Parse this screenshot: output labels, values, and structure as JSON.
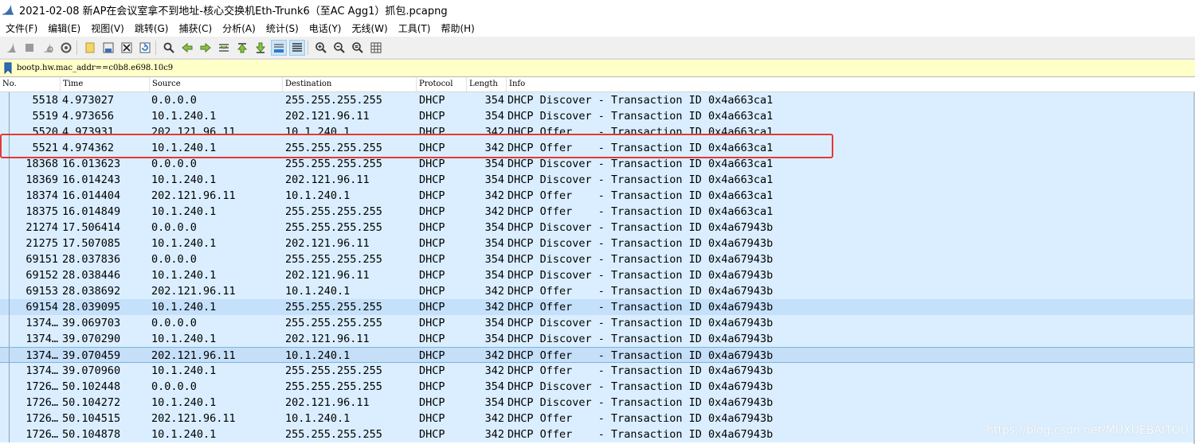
{
  "window": {
    "title": "2021-02-08 新AP在会议室拿不到地址-核心交换机Eth-Trunk6（至AC Agg1）抓包.pcapng"
  },
  "menu": [
    {
      "label": "文件(F)"
    },
    {
      "label": "编辑(E)"
    },
    {
      "label": "视图(V)"
    },
    {
      "label": "跳转(G)"
    },
    {
      "label": "捕获(C)"
    },
    {
      "label": "分析(A)"
    },
    {
      "label": "统计(S)"
    },
    {
      "label": "电话(Y)"
    },
    {
      "label": "无线(W)"
    },
    {
      "label": "工具(T)"
    },
    {
      "label": "帮助(H)"
    }
  ],
  "filter": {
    "value": "bootp.hw.mac_addr==c0b8.e698.10c9",
    "background_color": "#ffffc8"
  },
  "columns": [
    "No.",
    "Time",
    "Source",
    "Destination",
    "Protocol",
    "Length",
    "Info"
  ],
  "packets": [
    {
      "no": "5518",
      "time": "4.973027",
      "src": "0.0.0.0",
      "dst": "255.255.255.255",
      "proto": "DHCP",
      "len": "354",
      "info": "DHCP Discover - Transaction ID 0x4a663ca1"
    },
    {
      "no": "5519",
      "time": "4.973656",
      "src": "10.1.240.1",
      "dst": "202.121.96.11",
      "proto": "DHCP",
      "len": "354",
      "info": "DHCP Discover - Transaction ID 0x4a663ca1"
    },
    {
      "no": "5520",
      "time": "4.973931",
      "src": "202.121.96.11",
      "dst": "10.1.240.1",
      "proto": "DHCP",
      "len": "342",
      "info": "DHCP Offer    - Transaction ID 0x4a663ca1"
    },
    {
      "no": "5521",
      "time": "4.974362",
      "src": "10.1.240.1",
      "dst": "255.255.255.255",
      "proto": "DHCP",
      "len": "342",
      "info": "DHCP Offer    - Transaction ID 0x4a663ca1"
    },
    {
      "no": "18368",
      "time": "16.013623",
      "src": "0.0.0.0",
      "dst": "255.255.255.255",
      "proto": "DHCP",
      "len": "354",
      "info": "DHCP Discover - Transaction ID 0x4a663ca1"
    },
    {
      "no": "18369",
      "time": "16.014243",
      "src": "10.1.240.1",
      "dst": "202.121.96.11",
      "proto": "DHCP",
      "len": "354",
      "info": "DHCP Discover - Transaction ID 0x4a663ca1"
    },
    {
      "no": "18374",
      "time": "16.014404",
      "src": "202.121.96.11",
      "dst": "10.1.240.1",
      "proto": "DHCP",
      "len": "342",
      "info": "DHCP Offer    - Transaction ID 0x4a663ca1"
    },
    {
      "no": "18375",
      "time": "16.014849",
      "src": "10.1.240.1",
      "dst": "255.255.255.255",
      "proto": "DHCP",
      "len": "342",
      "info": "DHCP Offer    - Transaction ID 0x4a663ca1"
    },
    {
      "no": "21274",
      "time": "17.506414",
      "src": "0.0.0.0",
      "dst": "255.255.255.255",
      "proto": "DHCP",
      "len": "354",
      "info": "DHCP Discover - Transaction ID 0x4a67943b"
    },
    {
      "no": "21275",
      "time": "17.507085",
      "src": "10.1.240.1",
      "dst": "202.121.96.11",
      "proto": "DHCP",
      "len": "354",
      "info": "DHCP Discover - Transaction ID 0x4a67943b"
    },
    {
      "no": "69151",
      "time": "28.037836",
      "src": "0.0.0.0",
      "dst": "255.255.255.255",
      "proto": "DHCP",
      "len": "354",
      "info": "DHCP Discover - Transaction ID 0x4a67943b"
    },
    {
      "no": "69152",
      "time": "28.038446",
      "src": "10.1.240.1",
      "dst": "202.121.96.11",
      "proto": "DHCP",
      "len": "354",
      "info": "DHCP Discover - Transaction ID 0x4a67943b"
    },
    {
      "no": "69153",
      "time": "28.038692",
      "src": "202.121.96.11",
      "dst": "10.1.240.1",
      "proto": "DHCP",
      "len": "342",
      "info": "DHCP Offer    - Transaction ID 0x4a67943b"
    },
    {
      "no": "69154",
      "time": "28.039095",
      "src": "10.1.240.1",
      "dst": "255.255.255.255",
      "proto": "DHCP",
      "len": "342",
      "info": "DHCP Offer    - Transaction ID 0x4a67943b"
    },
    {
      "no": "1374…",
      "time": "39.069703",
      "src": "0.0.0.0",
      "dst": "255.255.255.255",
      "proto": "DHCP",
      "len": "354",
      "info": "DHCP Discover - Transaction ID 0x4a67943b"
    },
    {
      "no": "1374…",
      "time": "39.070290",
      "src": "10.1.240.1",
      "dst": "202.121.96.11",
      "proto": "DHCP",
      "len": "354",
      "info": "DHCP Discover - Transaction ID 0x4a67943b"
    },
    {
      "no": "1374…",
      "time": "39.070459",
      "src": "202.121.96.11",
      "dst": "10.1.240.1",
      "proto": "DHCP",
      "len": "342",
      "info": "DHCP Offer    - Transaction ID 0x4a67943b"
    },
    {
      "no": "1374…",
      "time": "39.070960",
      "src": "10.1.240.1",
      "dst": "255.255.255.255",
      "proto": "DHCP",
      "len": "342",
      "info": "DHCP Offer    - Transaction ID 0x4a67943b"
    },
    {
      "no": "1726…",
      "time": "50.102448",
      "src": "0.0.0.0",
      "dst": "255.255.255.255",
      "proto": "DHCP",
      "len": "354",
      "info": "DHCP Discover - Transaction ID 0x4a67943b"
    },
    {
      "no": "1726…",
      "time": "50.104272",
      "src": "10.1.240.1",
      "dst": "202.121.96.11",
      "proto": "DHCP",
      "len": "354",
      "info": "DHCP Discover - Transaction ID 0x4a67943b"
    },
    {
      "no": "1726…",
      "time": "50.104515",
      "src": "202.121.96.11",
      "dst": "10.1.240.1",
      "proto": "DHCP",
      "len": "342",
      "info": "DHCP Offer    - Transaction ID 0x4a67943b"
    },
    {
      "no": "1726…",
      "time": "50.104878",
      "src": "10.1.240.1",
      "dst": "255.255.255.255",
      "proto": "DHCP",
      "len": "342",
      "info": "DHCP Offer    - Transaction ID 0x4a67943b"
    }
  ],
  "selected_row": 16,
  "alt_rows": [
    13
  ],
  "highlight": {
    "row": 3,
    "color": "#e53935"
  },
  "row_color": "#daeeff",
  "watermark": "https://blog.csdn.net/MUXUEBAITOU",
  "toolbar_icons": [
    "start-capture-icon",
    "stop-capture-icon",
    "restart-capture-icon",
    "capture-options-icon",
    "open-file-icon",
    "save-file-icon",
    "close-file-icon",
    "reload-file-icon",
    "find-packet-icon",
    "go-back-icon",
    "go-forward-icon",
    "go-to-packet-icon",
    "go-first-icon",
    "go-last-icon",
    "auto-scroll-icon",
    "colorize-icon",
    "zoom-in-icon",
    "zoom-out-icon",
    "zoom-normal-icon",
    "resize-columns-icon"
  ]
}
